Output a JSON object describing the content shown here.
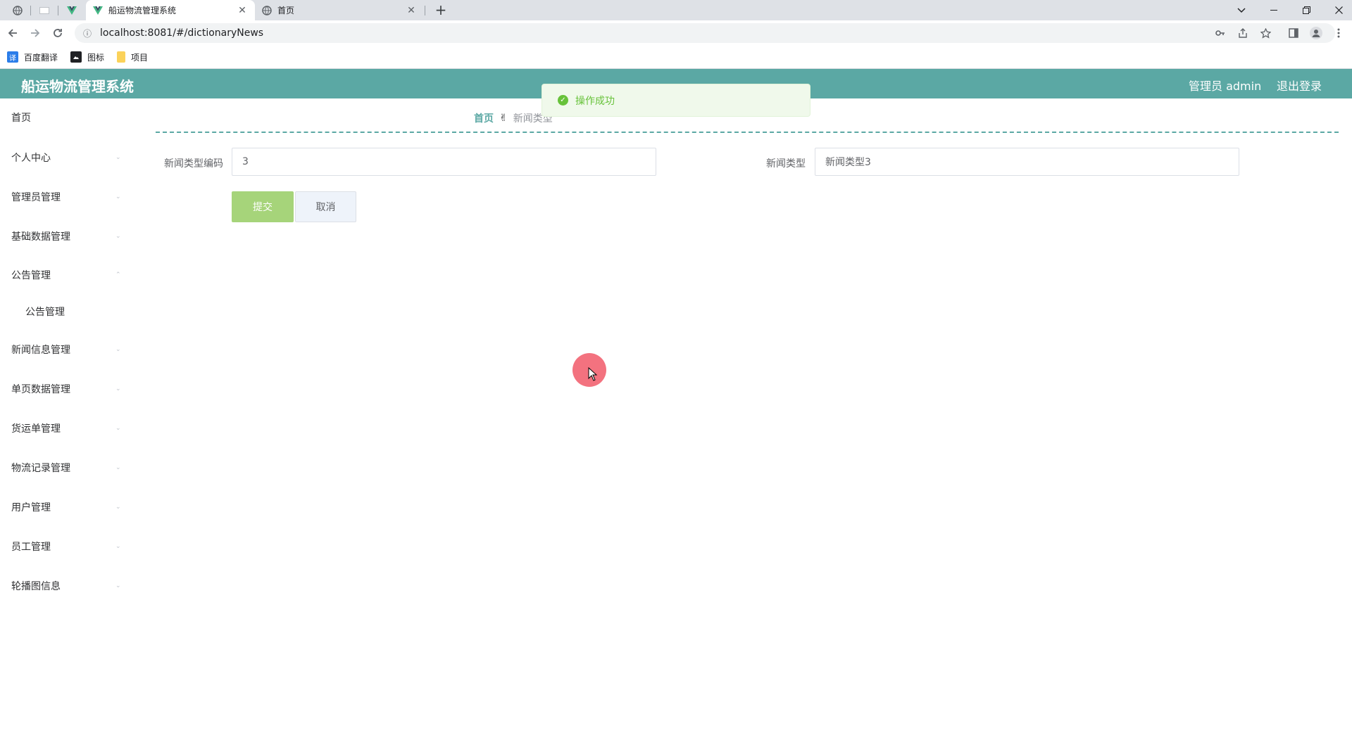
{
  "browser": {
    "tabs": [
      {
        "title": "船运物流管理系统",
        "close": "✕"
      },
      {
        "title": "首页",
        "close": "✕"
      }
    ],
    "new_tab": "+",
    "address": "localhost:8081/#/dictionaryNews",
    "bookmarks": [
      {
        "label": "百度翻译",
        "icon": "译"
      },
      {
        "label": "图标",
        "icon": ""
      },
      {
        "label": "项目",
        "icon": ""
      }
    ]
  },
  "app": {
    "title": "船运物流管理系统",
    "user": "管理员 admin",
    "logout": "退出登录",
    "accent": "#5ba8a4"
  },
  "sidebar": {
    "items": [
      {
        "label": "首页"
      },
      {
        "label": "个人中心"
      },
      {
        "label": "管理员管理"
      },
      {
        "label": "基础数据管理"
      },
      {
        "label": "公告管理"
      },
      {
        "label": "公告管理"
      },
      {
        "label": "新闻信息管理"
      },
      {
        "label": "单页数据管理"
      },
      {
        "label": "货运单管理"
      },
      {
        "label": "物流记录管理"
      },
      {
        "label": "用户管理"
      },
      {
        "label": "员工管理"
      },
      {
        "label": "轮播图信息"
      }
    ]
  },
  "breadcrumb": {
    "home": "首页",
    "current": "新闻类型"
  },
  "form": {
    "code_label": "新闻类型编码",
    "code_value": "3",
    "type_label": "新闻类型",
    "type_value": "新闻类型3",
    "submit": "提交",
    "cancel": "取消"
  },
  "toast": {
    "message": "操作成功",
    "color": "#67c23a"
  }
}
